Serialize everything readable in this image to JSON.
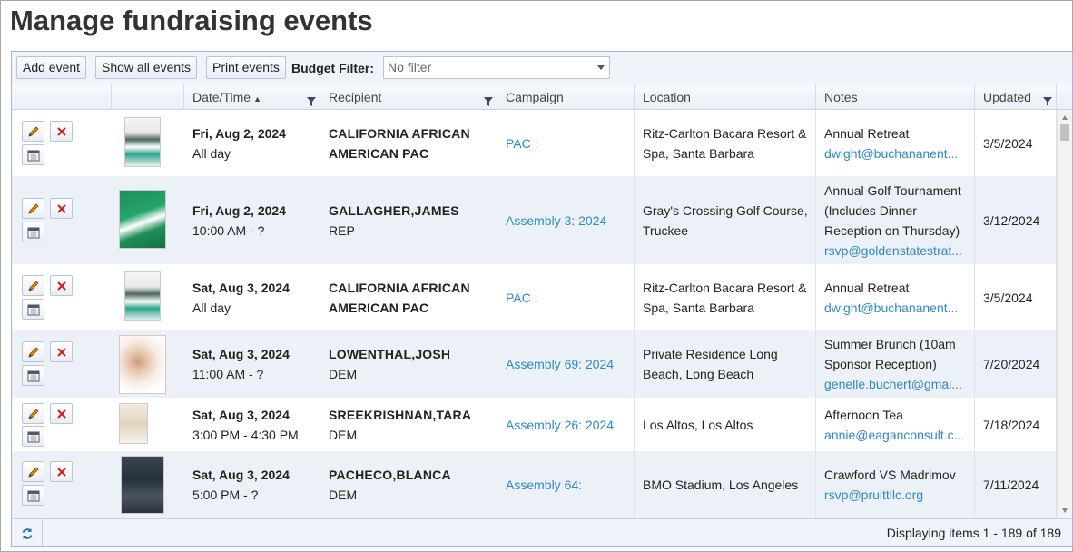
{
  "page": {
    "title": "Manage fundraising events"
  },
  "toolbar": {
    "add_event": "Add event",
    "show_all": "Show all events",
    "print": "Print events",
    "budget_filter_label": "Budget Filter:",
    "budget_filter_value": "No filter"
  },
  "columns": {
    "date": "Date/Time",
    "recipient": "Recipient",
    "campaign": "Campaign",
    "location": "Location",
    "notes": "Notes",
    "updated": "Updated"
  },
  "rows": [
    {
      "date": "Fri, Aug 2, 2024",
      "time": "All day",
      "recipient": "CALIFORNIA AFRICAN AMERICAN PAC",
      "party": "",
      "campaign": "PAC :",
      "location": "Ritz-Carlton Bacara Resort & Spa, Santa Barbara",
      "note": "Annual Retreat",
      "email": "dwight@buchananent...",
      "updated": "3/5/2024"
    },
    {
      "date": "Fri, Aug 2, 2024",
      "time": "10:00 AM - ?",
      "recipient": "GALLAGHER,JAMES",
      "party": "REP",
      "campaign": "Assembly 3: 2024",
      "location": "Gray's Crossing Golf Course, Truckee",
      "note": "Annual Golf Tournament (Includes Dinner Reception on Thursday)",
      "email": "rsvp@goldenstatestrat...",
      "updated": "3/12/2024"
    },
    {
      "date": "Sat, Aug 3, 2024",
      "time": "All day",
      "recipient": "CALIFORNIA AFRICAN AMERICAN PAC",
      "party": "",
      "campaign": "PAC :",
      "location": "Ritz-Carlton Bacara Resort & Spa, Santa Barbara",
      "note": "Annual Retreat",
      "email": "dwight@buchananent...",
      "updated": "3/5/2024"
    },
    {
      "date": "Sat, Aug 3, 2024",
      "time": "11:00 AM - ?",
      "recipient": "LOWENTHAL,JOSH",
      "party": "DEM",
      "campaign": "Assembly 69: 2024",
      "location": "Private Residence Long Beach, Long Beach",
      "note": "Summer Brunch (10am Sponsor Reception)",
      "email": "genelle.buchert@gmai...",
      "updated": "7/20/2024"
    },
    {
      "date": "Sat, Aug 3, 2024",
      "time": "3:00 PM - 4:30 PM",
      "recipient": "SREEKRISHNAN,TARA",
      "party": "DEM",
      "campaign": "Assembly 26: 2024",
      "location": "Los Altos, Los Altos",
      "note": "Afternoon Tea",
      "email": "annie@eaganconsult.c...",
      "updated": "7/18/2024"
    },
    {
      "date": "Sat, Aug 3, 2024",
      "time": "5:00 PM - ?",
      "recipient": "PACHECO,BLANCA",
      "party": "DEM",
      "campaign": "Assembly 64:",
      "location": "BMO Stadium, Los Angeles",
      "note": "Crawford VS Madrimov",
      "email": "rsvp@pruittllc.org",
      "updated": "7/11/2024"
    }
  ],
  "footer": {
    "status": "Displaying items 1 - 189 of 189"
  },
  "colors": {
    "link": "#2d89c8",
    "alt_row": "#ecf1f7",
    "header_bg": "#eaf0f8"
  },
  "icons": [
    "edit-pencil-icon",
    "delete-x-icon",
    "calendar-icon",
    "refresh-icon",
    "filter-icon",
    "sort-asc-icon"
  ]
}
